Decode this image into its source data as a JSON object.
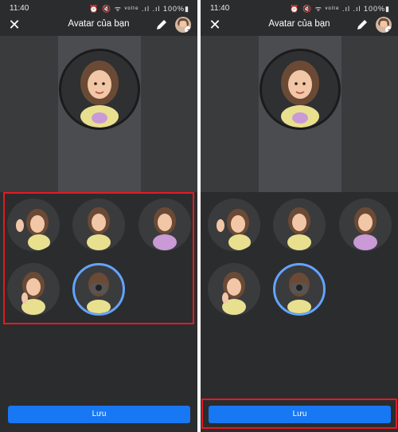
{
  "status": {
    "time": "11:40",
    "battery": "100%",
    "icons": "⏰ 🔇 ᯤ ᵛᵒˡᵗᵉ .ıl .ıl"
  },
  "header": {
    "title": "Avatar của bạn"
  },
  "save_label": "Lưu",
  "colors": {
    "panel_bg": "#2b2c2e",
    "accent": "#1877f2",
    "selected_ring": "#63a4ff",
    "highlight": "#e31b23"
  },
  "panels": [
    {
      "id": "left",
      "highlight": "sticker-grid"
    },
    {
      "id": "right",
      "highlight": "save-button"
    }
  ]
}
